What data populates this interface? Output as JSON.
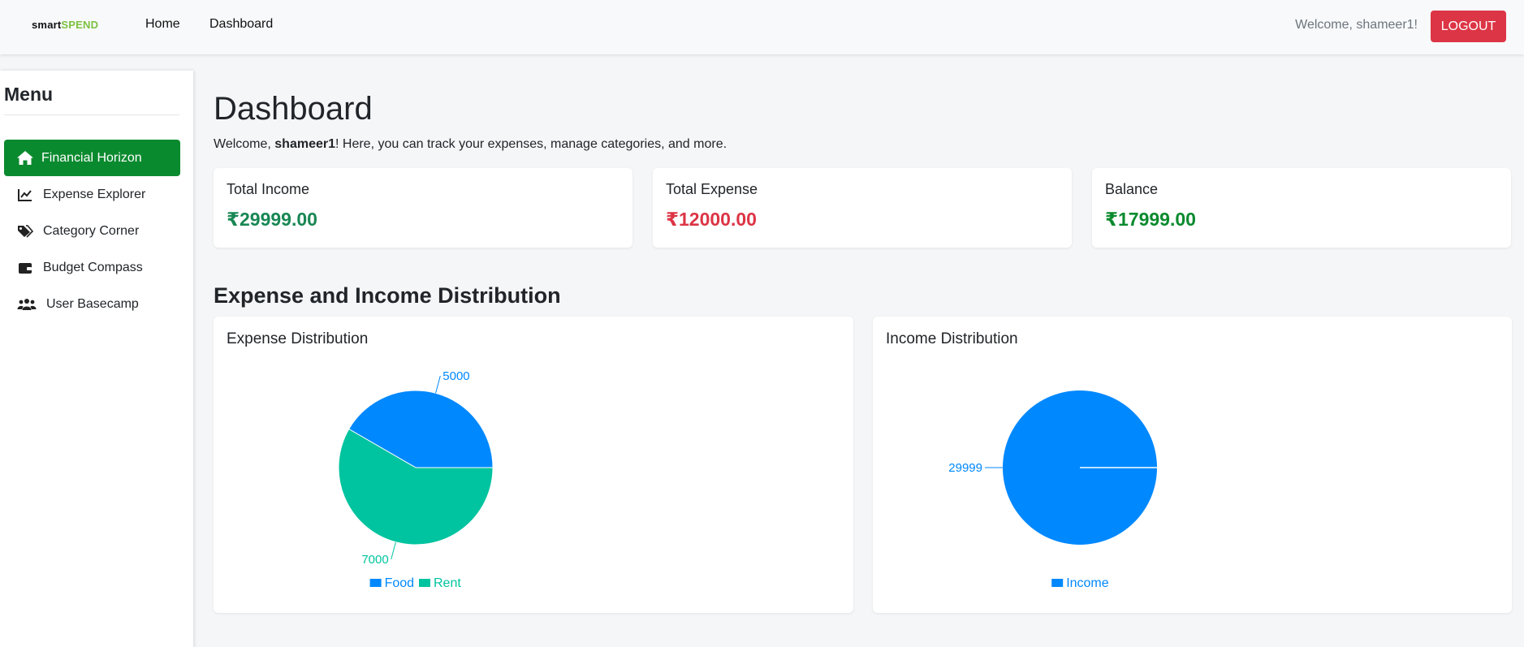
{
  "navbar": {
    "brand_part1": "smart",
    "brand_part2": "SPEND",
    "home_label": "Home",
    "dashboard_label": "Dashboard",
    "welcome_text": "Welcome, shameer1!",
    "logout_label": "LOGOUT"
  },
  "sidebar": {
    "title": "Menu",
    "items": [
      {
        "label": "Financial Horizon",
        "icon": "home-icon",
        "active": true
      },
      {
        "label": "Expense Explorer",
        "icon": "chart-line-icon",
        "active": false
      },
      {
        "label": "Category Corner",
        "icon": "tags-icon",
        "active": false
      },
      {
        "label": "Budget Compass",
        "icon": "wallet-icon",
        "active": false
      },
      {
        "label": "User Basecamp",
        "icon": "users-icon",
        "active": false
      }
    ]
  },
  "main": {
    "title": "Dashboard",
    "intro_prefix": "Welcome, ",
    "intro_user": "shameer1",
    "intro_suffix": "! Here, you can track your expenses, manage categories, and more.",
    "stats": [
      {
        "label": "Total Income",
        "value": "₹29999.00",
        "color": "#198754"
      },
      {
        "label": "Total Expense",
        "value": "₹12000.00",
        "color": "#dc3545"
      },
      {
        "label": "Balance",
        "value": "₹17999.00",
        "color": "#0a8a2e"
      }
    ],
    "section_title": "Expense and Income Distribution"
  },
  "colors": {
    "blue": "#0088fe",
    "teal": "#00c49f",
    "logout": "#dc3545",
    "active": "#0a8a2e"
  },
  "chart_data": [
    {
      "type": "pie",
      "title": "Expense Distribution",
      "categories": [
        "Food",
        "Rent"
      ],
      "values": [
        5000,
        7000
      ],
      "colors": [
        "#0088fe",
        "#00c49f"
      ],
      "legend": "bottom"
    },
    {
      "type": "pie",
      "title": "Income Distribution",
      "categories": [
        "Income"
      ],
      "values": [
        29999
      ],
      "colors": [
        "#0088fe"
      ],
      "legend": "bottom"
    }
  ]
}
